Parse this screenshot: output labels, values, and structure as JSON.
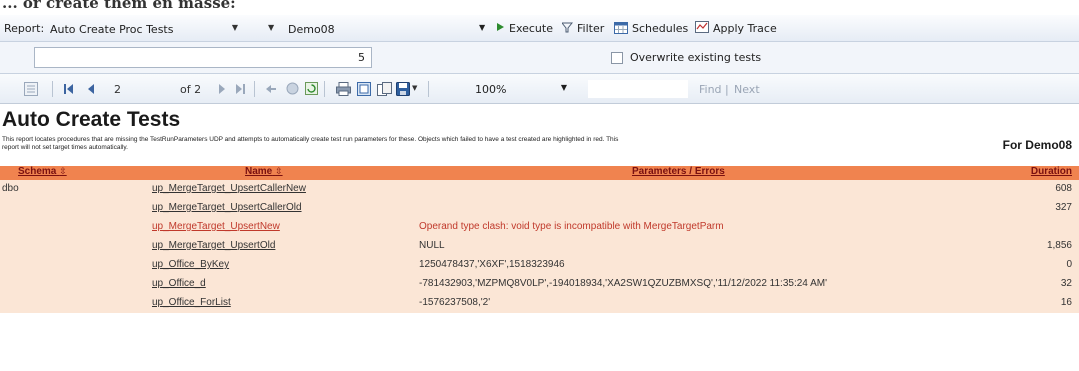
{
  "caption": "... or create them en masse:",
  "toolbar": {
    "report_label": "Report:",
    "report_value": "Auto Create Proc Tests",
    "server_value": "Demo08",
    "execute_label": "Execute",
    "filter_label": "Filter",
    "schedules_label": "Schedules",
    "apply_trace_label": "Apply Trace"
  },
  "parameters": {
    "input_value": "5",
    "overwrite_label": "Overwrite existing tests",
    "overwrite_checked": false
  },
  "viewer": {
    "current_page": "2",
    "page_of": "of 2",
    "zoom": "100%",
    "find_label": "Find",
    "find_separator": "|",
    "next_label": "Next"
  },
  "report": {
    "title": "Auto Create Tests",
    "for_label": "For Demo08",
    "description": "This report locates procedures that are missing the TestRunParameters UDP and attempts to automatically create test run parameters for these.  Objects which failed to have a test created are highlighted in red.  This report will not set target times automatically.",
    "columns": [
      "Schema",
      "Name",
      "Parameters / Errors",
      "Duration"
    ],
    "rows": [
      {
        "schema": "dbo",
        "name": "up_MergeTarget_UpsertCallerNew",
        "params": "",
        "duration": "608",
        "error": false
      },
      {
        "schema": "",
        "name": "up_MergeTarget_UpsertCallerOld",
        "params": "",
        "duration": "327",
        "error": false
      },
      {
        "schema": "",
        "name": "up_MergeTarget_UpsertNew",
        "params": "Operand type clash: void type is incompatible with MergeTargetParm",
        "duration": "",
        "error": true
      },
      {
        "schema": "",
        "name": "up_MergeTarget_UpsertOld",
        "params": "NULL",
        "duration": "1,856",
        "error": false
      },
      {
        "schema": "",
        "name": "up_Office_ByKey",
        "params": "1250478437,'X6XF',1518323946",
        "duration": "0",
        "error": false
      },
      {
        "schema": "",
        "name": "up_Office_d",
        "params": "-781432903,'MZPMQ8V0LP',-194018934,'XA2SW1QZUZBMXSQ','11/12/2022 11:35:24 AM'",
        "duration": "32",
        "error": false
      },
      {
        "schema": "",
        "name": "up_Office_ForList",
        "params": "-1576237508,'2'",
        "duration": "16",
        "error": false
      }
    ]
  },
  "colors": {
    "header_bg": "#f0834f",
    "header_text": "#7a1010",
    "row_bg": "#fbe6d6",
    "error_text": "#c0392b"
  }
}
